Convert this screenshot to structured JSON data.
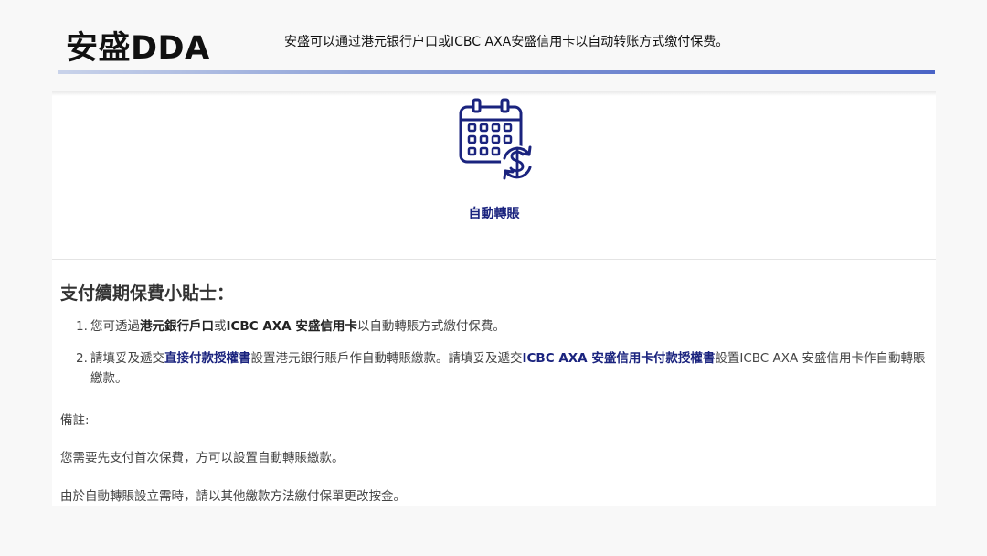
{
  "slide": {
    "title": "安盛DDA",
    "subtitle": "安盛可以通过港元银行户口或ICBC AXA安盛信用卡以自动转账方式缴付保费。"
  },
  "colors": {
    "accent_navy": "#1a237e",
    "rule_gradient_end": "#4a64c6"
  },
  "embed": {
    "icon": "calendar-dollar-autopay-icon",
    "auto_transfer_label": "自動轉賬",
    "tips_heading": "支付續期保費小貼士：",
    "tips": [
      {
        "number": "1.",
        "prefix": "您可透過",
        "bold1": "港元銀行戶口",
        "mid": "或",
        "bold2": "ICBC AXA 安盛信用卡",
        "suffix": "以自動轉賬方式繳付保費。"
      },
      {
        "number": "2.",
        "prefix": "請填妥及遞交",
        "link1": "直接付款授權書",
        "mid": "設置港元銀行賬戶作自動轉賬繳款。請填妥及遞交",
        "link2": "ICBC AXA 安盛信用卡付款授權書",
        "suffix": "設置ICBC AXA 安盛信用卡作自動轉賬繳款。"
      }
    ],
    "notes_label": "備註:",
    "note1": "您需要先支付首次保費，方可以設置自動轉賬繳款。",
    "note2": "由於自動轉賬設立需時，請以其他繳款方法繳付保單更改按金。"
  }
}
